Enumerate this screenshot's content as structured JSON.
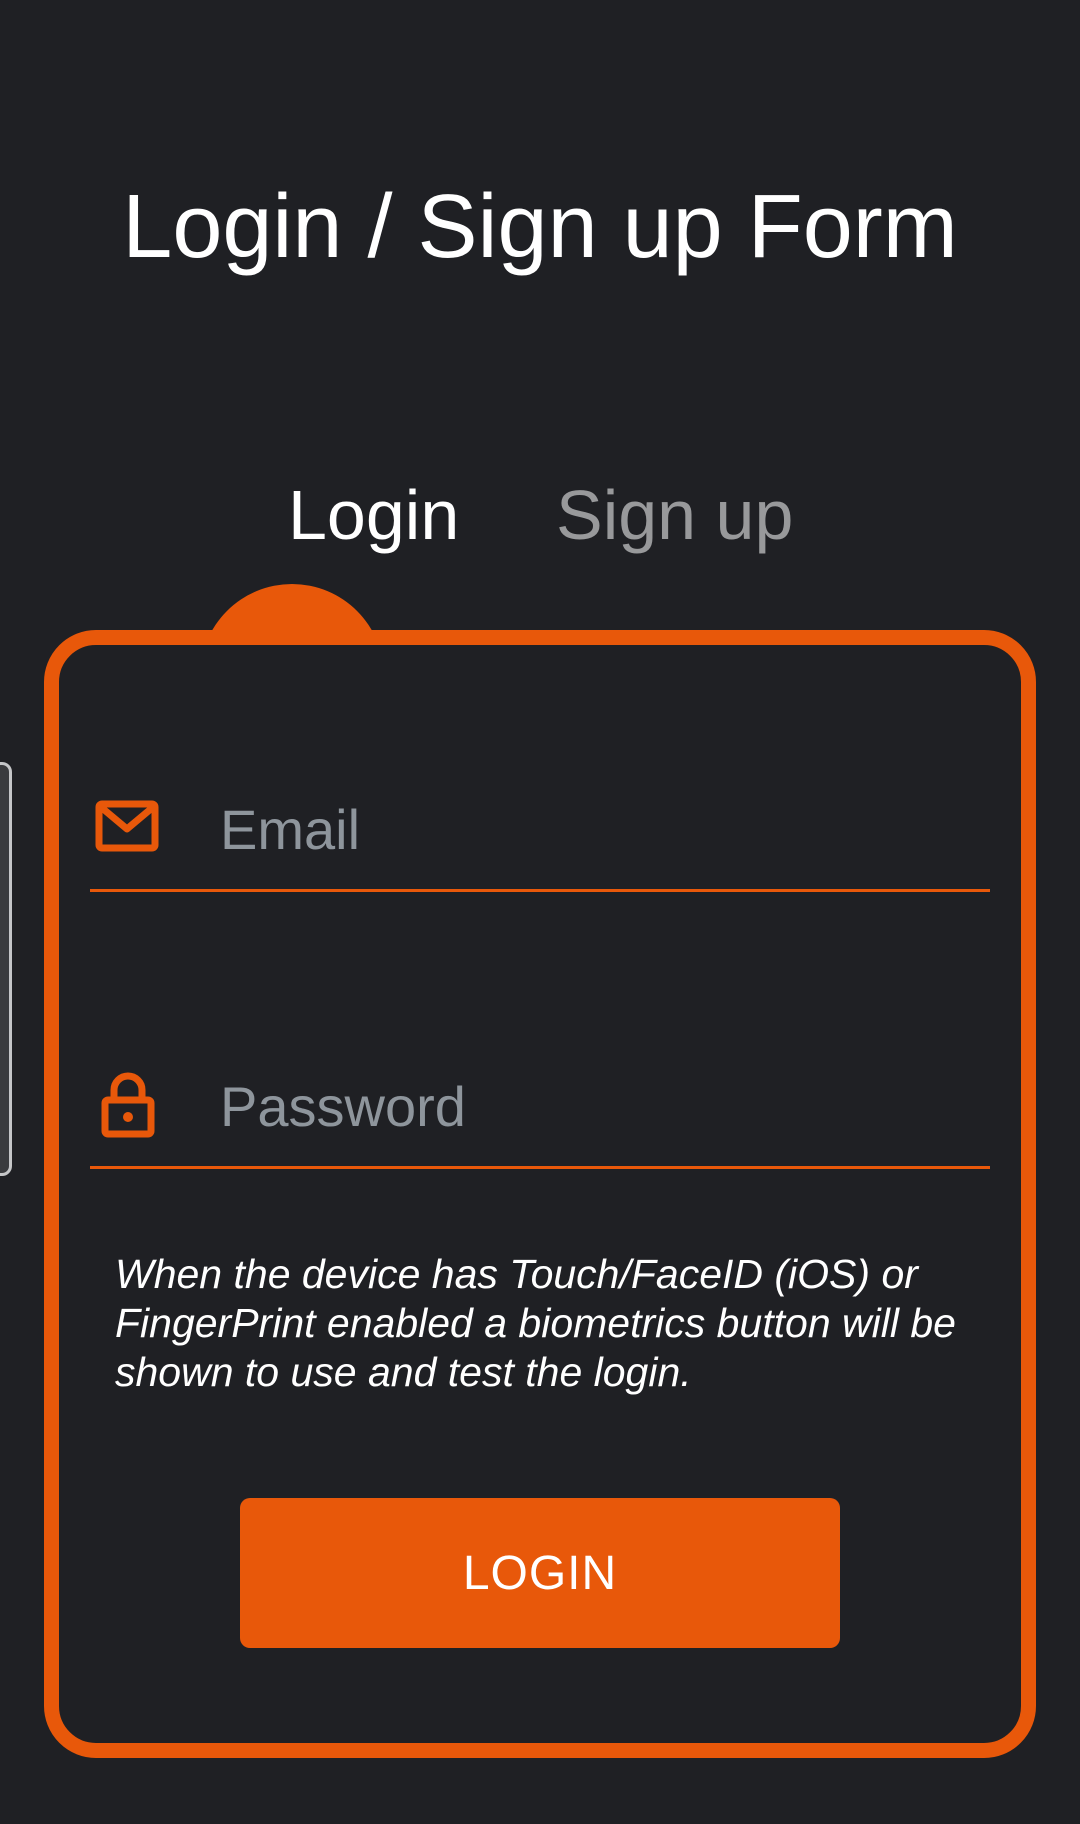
{
  "header": {
    "title": "Login / Sign up Form"
  },
  "tabs": [
    {
      "label": "Login",
      "active": true
    },
    {
      "label": "Sign up",
      "active": false
    }
  ],
  "form": {
    "email": {
      "placeholder": "Email",
      "value": "",
      "icon": "mail-icon"
    },
    "password": {
      "placeholder": "Password",
      "value": "",
      "icon": "lock-icon"
    },
    "info_text": "When the device has Touch/FaceID (iOS) or FingerPrint enabled a biometrics button will be shown to use and test the login.",
    "submit_label": "LOGIN"
  },
  "colors": {
    "background": "#1f2024",
    "accent": "#e8580a",
    "text": "#ffffff",
    "inactive_tab": "#98999b",
    "placeholder": "#8e959c"
  }
}
